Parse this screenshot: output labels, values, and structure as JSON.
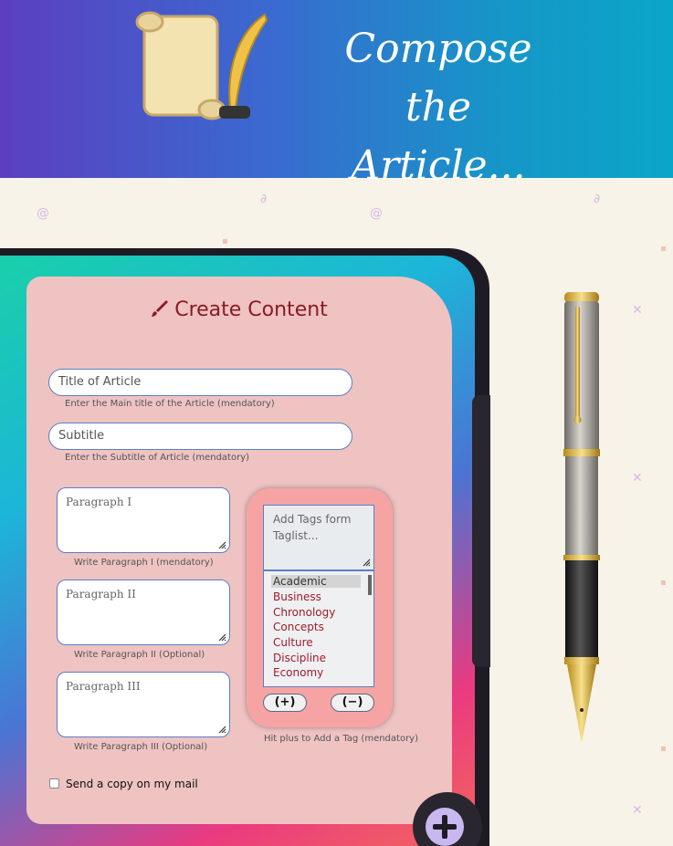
{
  "header": {
    "title_line1": "Compose the",
    "title_line2": "Article...",
    "logo_icon": "scroll-quill-icon"
  },
  "form": {
    "heading": "Create Content",
    "heading_icon": "pen-brush-icon",
    "title_field": {
      "placeholder": "Title of Article",
      "hint": "Enter the Main title of the Article (mendatory)"
    },
    "subtitle_field": {
      "placeholder": "Subtitle",
      "hint": "Enter the Subtitle of Article (mendatory)"
    },
    "paragraphs": [
      {
        "placeholder": "Paragraph I",
        "hint": "Write Paragraph I (mendatory)"
      },
      {
        "placeholder": "Paragraph II",
        "hint": "Write Paragraph II (Optional)"
      },
      {
        "placeholder": "Paragraph III",
        "hint": "Write Paragraph III (Optional)"
      }
    ],
    "tags": {
      "placeholder": "Add Tags form Taglist...",
      "options": [
        "Academic",
        "Business",
        "Chronology",
        "Concepts",
        "Culture",
        "Discipline",
        "Economy"
      ],
      "selected": "Academic",
      "add_label": "(+)",
      "remove_label": "(−)",
      "hint": "Hit plus to Add a Tag (mendatory)"
    },
    "send_copy_label": "Send a copy on my mail"
  },
  "colors": {
    "accent": "#8a1a26",
    "card": "#eec3c2",
    "tag_panel": "#f6a3a3"
  }
}
